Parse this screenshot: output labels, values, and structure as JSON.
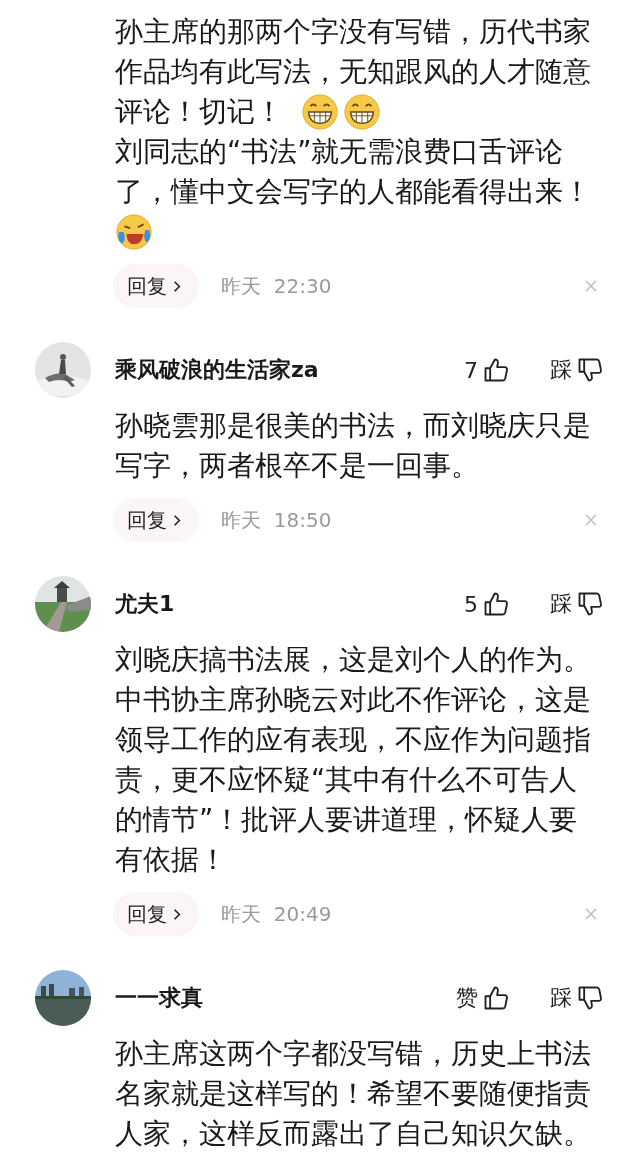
{
  "comments": [
    {
      "body": [
        [
          {
            "kind": "text",
            "text": "孙主席的那两个字没有写错，历代书家"
          }
        ],
        [
          {
            "kind": "text",
            "text": "作品均有此写法，无知跟风的人才随意"
          }
        ],
        [
          {
            "kind": "text",
            "text": "评论！切记！"
          },
          {
            "kind": "grin"
          },
          {
            "kind": "grin"
          }
        ],
        [
          {
            "kind": "text",
            "text": "刘同志的“书法”就无需浪费口舌评论"
          }
        ],
        [
          {
            "kind": "text",
            "text": "了，懂中文会写字的人都能看得出来！"
          }
        ],
        [
          {
            "kind": "cry"
          }
        ]
      ],
      "reply": "回复",
      "time": "昨天  22:30"
    },
    {
      "user": {
        "name": "乘风破浪的生活家za"
      },
      "like": "7",
      "dislike": "踩",
      "body": [
        [
          {
            "kind": "text",
            "text": "孙晓雲那是很美的书法，而刘晓庆只是"
          }
        ],
        [
          {
            "kind": "text",
            "text": "写字，两者根卒不是一回事。"
          }
        ]
      ],
      "reply": "回复",
      "time": "昨天  18:50"
    },
    {
      "user": {
        "name": "尤夫1"
      },
      "like": "5",
      "dislike": "踩",
      "body": [
        [
          {
            "kind": "text",
            "text": "刘晓庆搞书法展，这是刘个人的作为。"
          }
        ],
        [
          {
            "kind": "text",
            "text": "中书协主席孙晓云对此不作评论，这是"
          }
        ],
        [
          {
            "kind": "text",
            "text": "领导工作的应有表现，不应作为问题指"
          }
        ],
        [
          {
            "kind": "text",
            "text": "责，更不应怀疑“其中有什么不可告人"
          }
        ],
        [
          {
            "kind": "text",
            "text": "的情节”！批评人要讲道理，怀疑人要"
          }
        ],
        [
          {
            "kind": "text",
            "text": "有依据！"
          }
        ]
      ],
      "reply": "回复",
      "time": "昨天  20:49"
    },
    {
      "user": {
        "name": "一一求真"
      },
      "like": "赞",
      "dislike": "踩",
      "body": [
        [
          {
            "kind": "text",
            "text": "孙主席这两个字都没写错，历史上书法"
          }
        ],
        [
          {
            "kind": "text",
            "text": "名家就是这样写的！希望不要随便指责"
          }
        ],
        [
          {
            "kind": "text",
            "text": "人家，这样反而露出了自己知识欠缺。"
          }
        ]
      ]
    }
  ]
}
